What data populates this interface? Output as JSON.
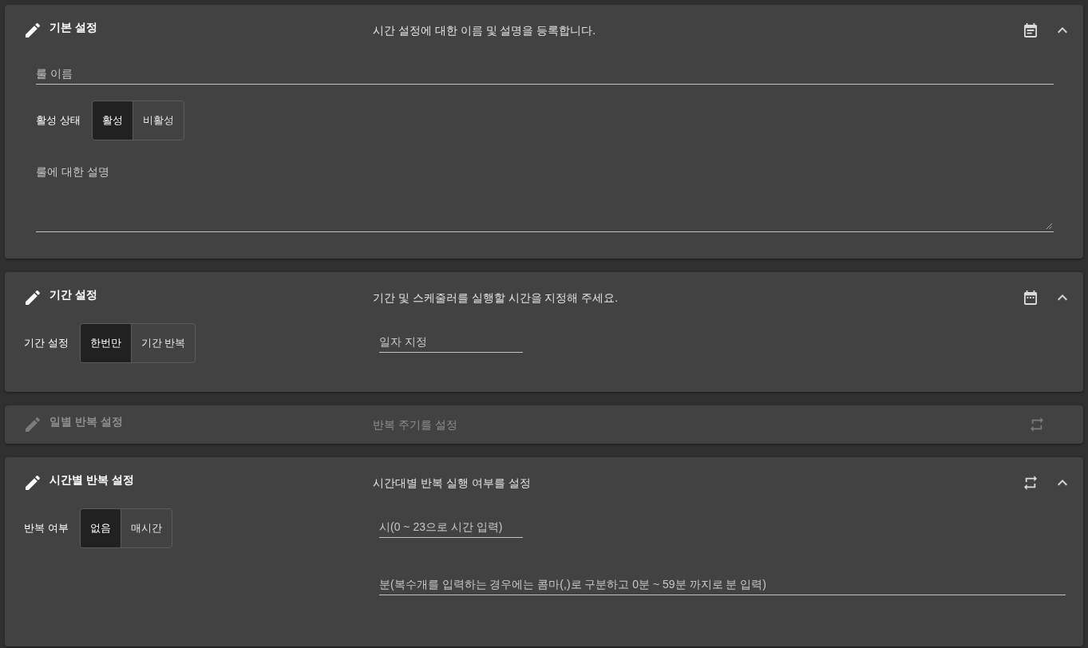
{
  "panels": [
    {
      "kind": "notes",
      "title": "기본 설정",
      "description": "시간 설정에 대한 이름 및 설명을 등록합니다.",
      "expanded": true,
      "disabled": false,
      "fields": [
        {
          "kind": "text",
          "placeholder": "룰 이름"
        },
        {
          "kind": "toggle",
          "label": "활성 상태",
          "options": [
            {
              "label": "활성",
              "selected": true
            },
            {
              "label": "비활성",
              "selected": false
            }
          ]
        },
        {
          "kind": "textarea",
          "placeholder": "룰에 대한 설명"
        }
      ]
    },
    {
      "kind": "calendar",
      "title": "기간 설정",
      "description": "기간 및 스케줄러를 실행할 시간을 지정해 주세요.",
      "expanded": true,
      "disabled": false,
      "left": [
        {
          "kind": "toggle",
          "label": "기간 설정",
          "options": [
            {
              "label": "한번만",
              "selected": true
            },
            {
              "label": "기간 반복",
              "selected": false
            }
          ]
        }
      ],
      "right": [
        {
          "kind": "short",
          "placeholder": "일자 지정"
        }
      ]
    },
    {
      "kind": "repeat",
      "title": "일별 반복 설정",
      "description": "반복 주기를 설정",
      "expanded": false,
      "disabled": true
    },
    {
      "kind": "repeat",
      "title": "시간별 반복 설정",
      "description": "시간대별 반복 실행 여부를 설정",
      "expanded": true,
      "disabled": false,
      "left": [
        {
          "kind": "toggle",
          "label": "반복 여부",
          "options": [
            {
              "label": "없음",
              "selected": true
            },
            {
              "label": "매시간",
              "selected": false
            }
          ]
        }
      ],
      "right": [
        {
          "kind": "short",
          "placeholder": "시(0 ~ 23으로 시간 입력)"
        },
        {
          "kind": "text",
          "placeholder": "분(복수개를 입력하는 경우에는 콤마(,)로 구분하고 0분 ~ 59분 까지로 분 입력)"
        }
      ]
    }
  ]
}
